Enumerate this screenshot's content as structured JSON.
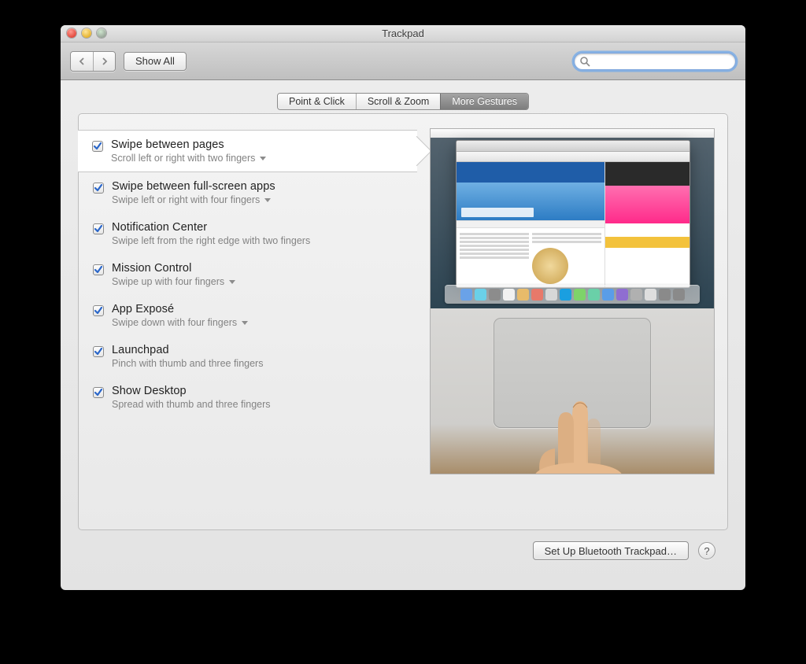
{
  "window": {
    "title": "Trackpad"
  },
  "toolbar": {
    "show_all": "Show All",
    "search_placeholder": ""
  },
  "tabs": [
    {
      "label": "Point & Click",
      "active": false
    },
    {
      "label": "Scroll & Zoom",
      "active": false
    },
    {
      "label": "More Gestures",
      "active": true
    }
  ],
  "gestures": [
    {
      "title": "Swipe between pages",
      "desc": "Scroll left or right with two fingers",
      "checked": true,
      "dropdown": true,
      "selected": true
    },
    {
      "title": "Swipe between full-screen apps",
      "desc": "Swipe left or right with four fingers",
      "checked": true,
      "dropdown": true,
      "selected": false
    },
    {
      "title": "Notification Center",
      "desc": "Swipe left from the right edge with two fingers",
      "checked": true,
      "dropdown": false,
      "selected": false
    },
    {
      "title": "Mission Control",
      "desc": "Swipe up with four fingers",
      "checked": true,
      "dropdown": true,
      "selected": false
    },
    {
      "title": "App Exposé",
      "desc": "Swipe down with four fingers",
      "checked": true,
      "dropdown": true,
      "selected": false
    },
    {
      "title": "Launchpad",
      "desc": "Pinch with thumb and three fingers",
      "checked": true,
      "dropdown": false,
      "selected": false
    },
    {
      "title": "Show Desktop",
      "desc": "Spread with thumb and three fingers",
      "checked": true,
      "dropdown": false,
      "selected": false
    }
  ],
  "footer": {
    "setup_bt": "Set Up Bluetooth Trackpad…",
    "help": "?"
  },
  "dock_colors": [
    "#6aa2e8",
    "#6ad0e8",
    "#8c8c8c",
    "#f1f1f1",
    "#e8bb6a",
    "#e8796a",
    "#d7d7d7",
    "#1a9fe0",
    "#7ed36a",
    "#6ad0a8",
    "#5a9de8",
    "#8f6ed1",
    "#b0b0b0",
    "#dedede",
    "#8a8a8a",
    "#8a8a8a"
  ]
}
